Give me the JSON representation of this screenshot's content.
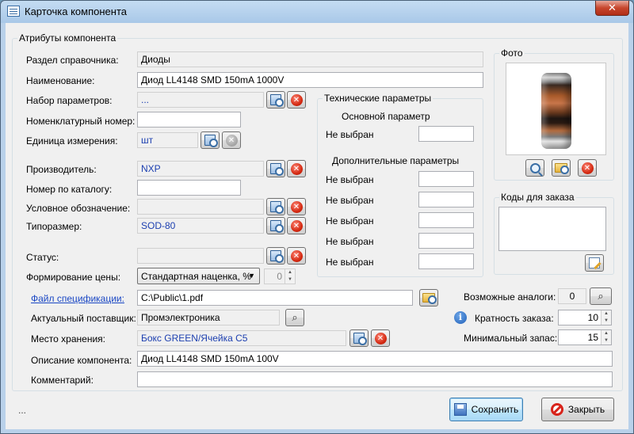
{
  "window": {
    "title": "Карточка компонента",
    "close_glyph": "✕"
  },
  "attributes": {
    "legend": "Атрибуты компонента",
    "section_label": "Раздел справочника:",
    "section_value": "Диоды",
    "name_label": "Наименование:",
    "name_value": "Диод LL4148 SMD 150mA 1000V",
    "params_label": "Набор параметров:",
    "params_value": "...",
    "nomen_label": "Номенклатурный номер:",
    "nomen_value": "",
    "unit_label": "Единица измерения:",
    "unit_value": "шт",
    "manuf_label": "Производитель:",
    "manuf_value": "NXP",
    "catalog_label": "Номер по каталогу:",
    "catalog_value": "",
    "symbol_label": "Условное обозначение:",
    "symbol_value": "",
    "size_label": "Типоразмер:",
    "size_value": "SOD-80",
    "status_label": "Статус:",
    "status_value": "",
    "price_label": "Формирование цены:",
    "price_value": "Стандартная наценка, %",
    "price_spin": "0",
    "spec_label": "Файл спецификации:",
    "spec_value": "C:\\Public\\1.pdf",
    "supplier_label": "Актуальный поставщик:",
    "supplier_value": "Промэлектроника",
    "storage_label": "Место хранения:",
    "storage_value": "Бокс GREEN/Ячейка C5",
    "desc_label": "Описание компонента:",
    "desc_value": "Диод LL4148 SMD 150mA 100V",
    "comment_label": "Комментарий:",
    "comment_value": ""
  },
  "tech": {
    "legend": "Технические параметры",
    "main_title": "Основной параметр",
    "extra_title": "Дополнительные параметры",
    "not_selected": "Не выбран"
  },
  "photo": {
    "legend": "Фото"
  },
  "codes": {
    "legend": "Коды для заказа"
  },
  "right": {
    "analogs_label": "Возможные аналоги:",
    "analogs_value": "0",
    "multiplicity_label": "Кратность заказа:",
    "multiplicity_value": "10",
    "min_stock_label": "Минимальный запас:",
    "min_stock_value": "15",
    "info_glyph": "i"
  },
  "buttons": {
    "save": "Сохранить",
    "close": "Закрыть",
    "remove_glyph": "✕",
    "binoc_glyph": "⌕"
  },
  "status": {
    "text": "..."
  }
}
